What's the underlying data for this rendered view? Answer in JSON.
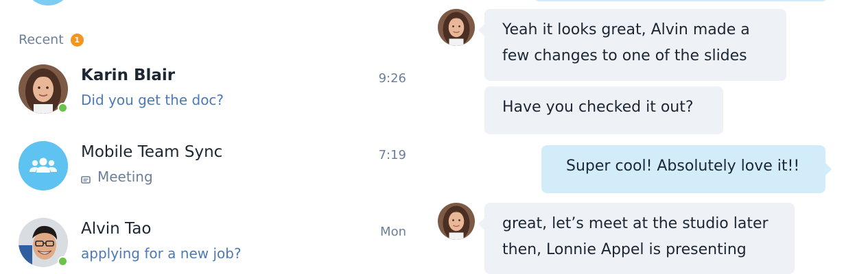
{
  "sidebar": {
    "recent_label": "Recent",
    "recent_count": "1",
    "conversations": [
      {
        "name": "Karin Blair",
        "preview": "Did you get the doc?",
        "time": "9:26",
        "avatar_icon": "person-avatar-icon",
        "online": true
      },
      {
        "name": "Mobile Team Sync",
        "preview": "Meeting",
        "time": "7:19",
        "avatar_icon": "group-icon",
        "online": false
      },
      {
        "name": "Alvin Tao",
        "preview": "applying for a new job?",
        "time": "Mon",
        "avatar_icon": "person-avatar-icon",
        "online": true
      }
    ]
  },
  "chat": {
    "messages": [
      {
        "direction": "incoming",
        "line1": "Yeah it looks great, Alvin made a",
        "line2": "few changes to one of the slides"
      },
      {
        "direction": "incoming",
        "line1": "Have you checked it out?"
      },
      {
        "direction": "outgoing",
        "line1": "Super cool! Absolutely love it!!"
      },
      {
        "direction": "incoming",
        "line1": "great, let’s meet at the studio later",
        "line2": "then, Lonnie Appel is presenting"
      }
    ]
  },
  "colors": {
    "accent_blue": "#4a7bb5",
    "presence_green": "#6cc24a",
    "badge_orange": "#f5951d",
    "group_avatar": "#5ec3f0",
    "incoming_bubble": "#eef1f5",
    "outgoing_bubble": "#d3ecf9"
  }
}
